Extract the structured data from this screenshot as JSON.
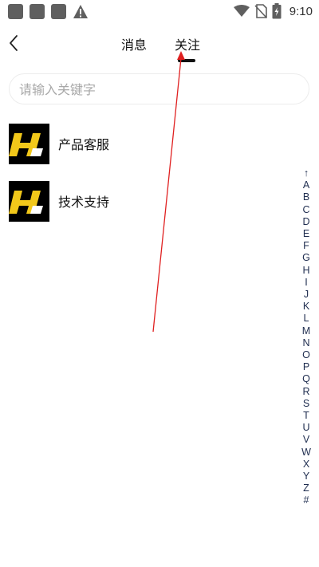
{
  "status_bar": {
    "time": "9:10",
    "icons": [
      "app-notification-icon",
      "app-notification-icon",
      "app-notification-icon",
      "warning-icon",
      "wifi-icon",
      "no-sim-icon",
      "battery-charging-icon"
    ]
  },
  "header": {
    "tabs": [
      {
        "label": "消息"
      },
      {
        "label": "关注"
      }
    ],
    "active_tab": "关注"
  },
  "search": {
    "placeholder": "请输入关键字",
    "value": ""
  },
  "contacts": [
    {
      "name": "产品客服",
      "avatar": "brand-logo"
    },
    {
      "name": "技术支持",
      "avatar": "brand-logo"
    }
  ],
  "alphabet_index": [
    "↑",
    "A",
    "B",
    "C",
    "D",
    "E",
    "F",
    "G",
    "H",
    "I",
    "J",
    "K",
    "L",
    "M",
    "N",
    "O",
    "P",
    "Q",
    "R",
    "S",
    "T",
    "U",
    "V",
    "W",
    "X",
    "Y",
    "Z",
    "#"
  ],
  "colors": {
    "accent": "#111111",
    "logo_yellow": "#f2c81a",
    "index_text": "#1f2d4f",
    "annotation": "#e02020"
  }
}
